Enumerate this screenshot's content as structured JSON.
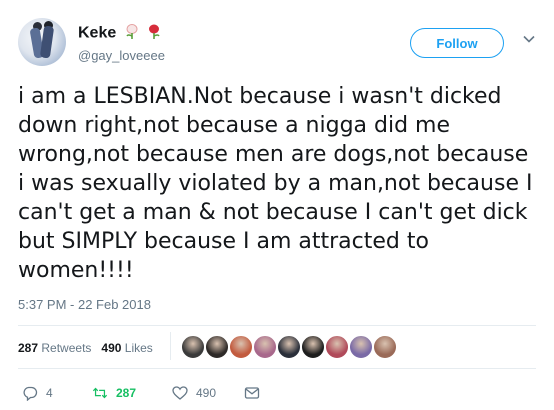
{
  "user": {
    "display_name": "Keke",
    "handle": "@gay_loveeee",
    "emojis": [
      "white-rose",
      "red-rose"
    ]
  },
  "follow_button": {
    "label": "Follow"
  },
  "tweet": {
    "text": "i am a LESBIAN.Not because i wasn't dicked\ndown right,not because a nigga did me\nwrong,not because men are dogs,not because\ni was sexually violated by a man,not because I\ncan't get a man & not because I can't get dick\nbut SIMPLY because I am attracted to\nwomen!!!!",
    "timestamp": "5:37 PM - 22 Feb 2018"
  },
  "stats": {
    "retweets_count": "287",
    "retweets_label": "Retweets",
    "likes_count": "490",
    "likes_label": "Likes"
  },
  "likers": [
    {
      "color": "#3a3a3a"
    },
    {
      "color": "#2e2a28"
    },
    {
      "color": "#c25b3f"
    },
    {
      "color": "#a8688c"
    },
    {
      "color": "#2a2f3a"
    },
    {
      "color": "#1e1e1e"
    },
    {
      "color": "#b04a5a"
    },
    {
      "color": "#7a6aa6"
    },
    {
      "color": "#9a6a58"
    }
  ],
  "actions": {
    "reply_count": "4",
    "retweet_count": "287",
    "like_count": "490"
  },
  "colors": {
    "brand": "#1da1f2",
    "retweet": "#17bf63",
    "muted": "#657786"
  }
}
